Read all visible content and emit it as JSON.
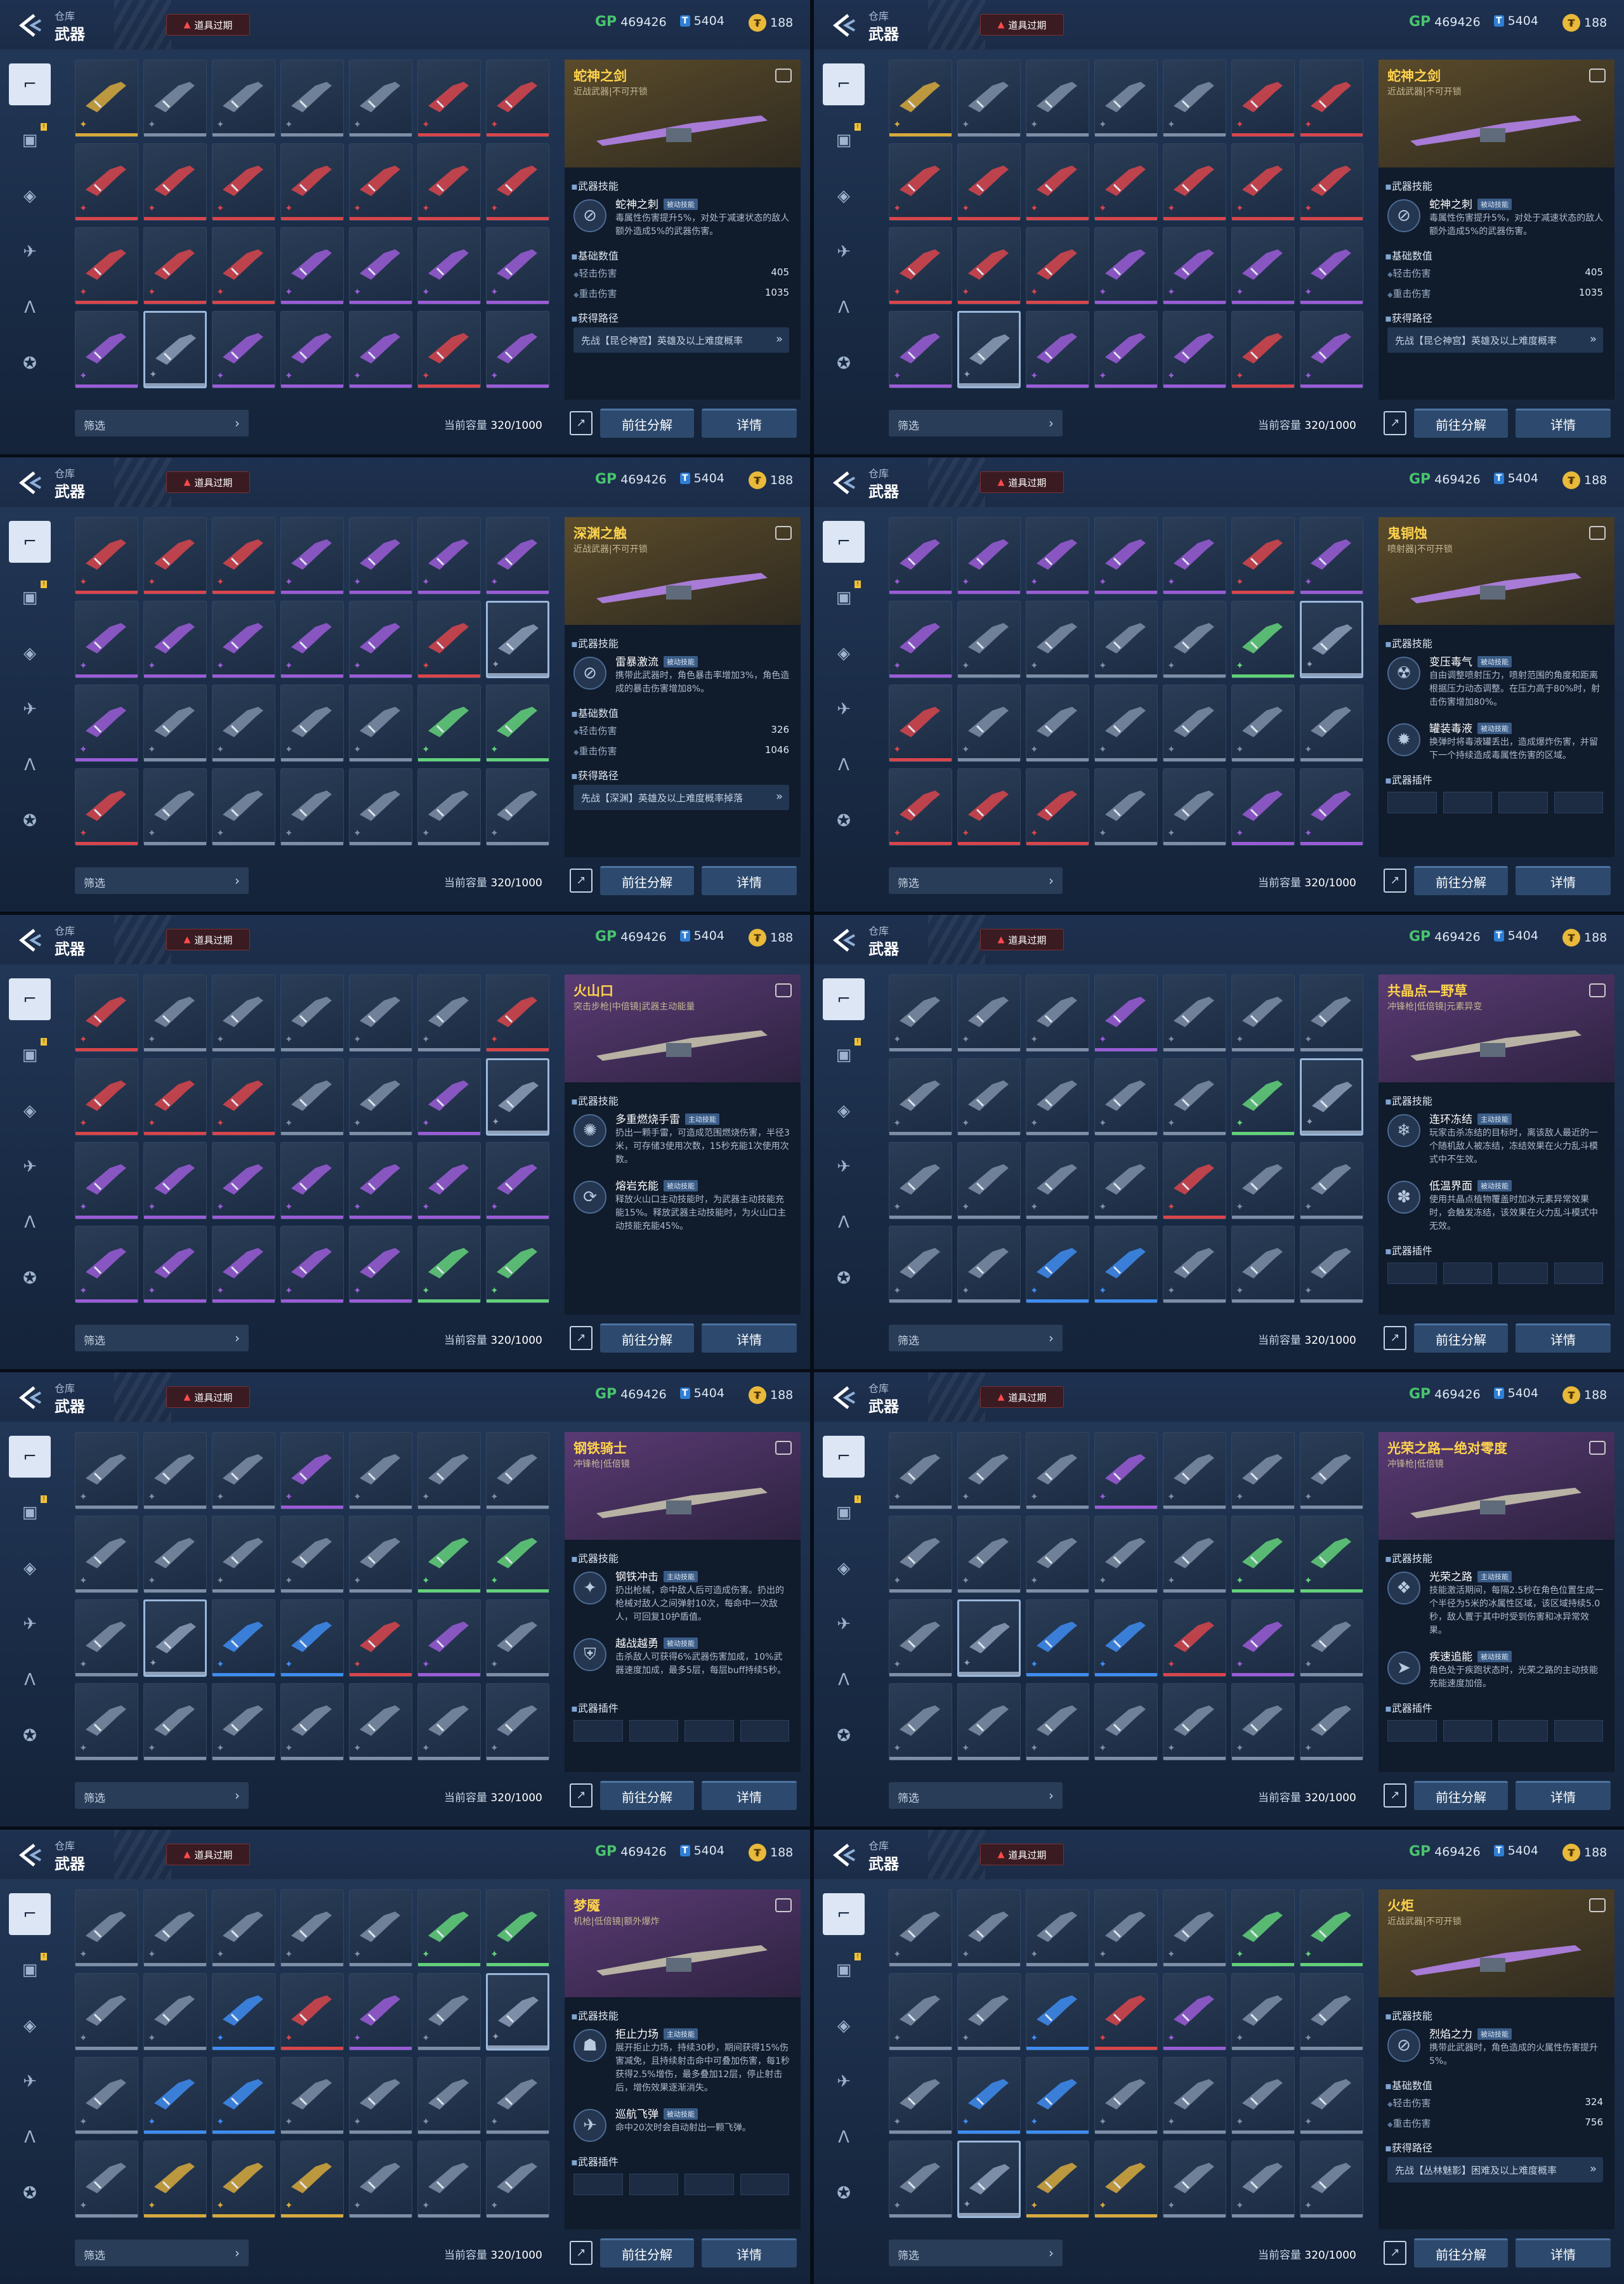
{
  "header": {
    "crumb": "仓库",
    "title": "武器",
    "warning": "道具过期",
    "gp": "469426",
    "tickets": "5404",
    "coins": "188"
  },
  "footer": {
    "filter": "筛选",
    "capacity_label": "当前容量",
    "capacity": "320/1000",
    "decompose": "前往分解",
    "details": "详情"
  },
  "tabs": [
    "pistol-icon",
    "armor-icon",
    "grenade-icon",
    "drone-icon",
    "chip-icon",
    "medal-icon"
  ],
  "colors": {
    "gold": "#d7a93c",
    "purple": "#9a5cd6",
    "red": "#d8454c",
    "green": "#63d17a",
    "blue": "#3e8cf0",
    "grey": "#7d8ea6"
  },
  "panels": [
    {
      "rows": [
        [
          "gold",
          "grey",
          "grey",
          "grey",
          "grey",
          "red",
          "red"
        ],
        [
          "red",
          "red",
          "red",
          "red",
          "red",
          "red",
          "red"
        ],
        [
          "red",
          "red",
          "red",
          "purple",
          "purple",
          "purple",
          "purple"
        ],
        [
          "purple",
          "sel",
          "purple",
          "purple",
          "purple",
          "red",
          "purple"
        ]
      ],
      "tone": "gold",
      "name": "蛇神之剑",
      "sub": "近战武器|不可开锁",
      "sec1": "武器技能",
      "skills": [
        {
          "n": "蛇神之刺",
          "t": "被动技能",
          "d": "毒属性伤害提升5%，对处于减速状态的敌人额外造成5%的武器伤害。",
          "i": "⊘"
        }
      ],
      "sec2": "基础数值",
      "stats": [
        [
          "轻击伤害",
          "405"
        ],
        [
          "重击伤害",
          "1035"
        ]
      ],
      "sec3": "获得路径",
      "path": "先战【昆仑神宫】英雄及以上难度概率"
    },
    {
      "rows": [
        [
          "gold",
          "grey",
          "grey",
          "grey",
          "grey",
          "red",
          "red"
        ],
        [
          "red",
          "red",
          "red",
          "red",
          "red",
          "red",
          "red"
        ],
        [
          "red",
          "red",
          "red",
          "purple",
          "purple",
          "purple",
          "purple"
        ],
        [
          "purple",
          "sel",
          "purple",
          "purple",
          "purple",
          "red",
          "purple"
        ]
      ],
      "tone": "gold",
      "name": "蛇神之剑",
      "sub": "近战武器|不可开锁",
      "sec1": "武器技能",
      "skills": [
        {
          "n": "蛇神之刺",
          "t": "被动技能",
          "d": "毒属性伤害提升5%，对处于减速状态的敌人额外造成5%的武器伤害。",
          "i": "⊘"
        }
      ],
      "sec2": "基础数值",
      "stats": [
        [
          "轻击伤害",
          "405"
        ],
        [
          "重击伤害",
          "1035"
        ]
      ],
      "sec3": "获得路径",
      "path": "先战【昆仑神宫】英雄及以上难度概率"
    },
    {
      "rows": [
        [
          "red",
          "red",
          "red",
          "purple",
          "purple",
          "purple",
          "purple"
        ],
        [
          "purple",
          "purple",
          "purple",
          "purple",
          "purple",
          "red",
          "sel"
        ],
        [
          "purple",
          "grey",
          "grey",
          "grey",
          "grey",
          "green",
          "green"
        ],
        [
          "red",
          "grey",
          "grey",
          "grey",
          "grey",
          "grey",
          "grey"
        ]
      ],
      "tone": "gold",
      "name": "深渊之触",
      "sub": "近战武器|不可开锁",
      "sec1": "武器技能",
      "skills": [
        {
          "n": "雷暴激流",
          "t": "被动技能",
          "d": "携带此武器时，角色暴击率增加3%，角色造成的暴击伤害增加8%。",
          "i": "⊘"
        }
      ],
      "sec2": "基础数值",
      "stats": [
        [
          "轻击伤害",
          "326"
        ],
        [
          "重击伤害",
          "1046"
        ]
      ],
      "sec3": "获得路径",
      "path": "先战【深渊】英雄及以上难度概率掉落"
    },
    {
      "rows": [
        [
          "purple",
          "purple",
          "purple",
          "purple",
          "purple",
          "red",
          "purple"
        ],
        [
          "purple",
          "grey",
          "grey",
          "grey",
          "grey",
          "green",
          "sel"
        ],
        [
          "red",
          "grey",
          "grey",
          "grey",
          "grey",
          "grey",
          "grey"
        ],
        [
          "red",
          "red",
          "red",
          "grey",
          "grey",
          "purple",
          "purple"
        ]
      ],
      "tone": "gold",
      "name": "鬼铜蚀",
      "sub": "喷射器|不可开锁",
      "sec1": "武器技能",
      "skills": [
        {
          "n": "变压毒气",
          "t": "被动技能",
          "d": "自由调整喷射压力，喷射范围的角度和距离根据压力动态调整。在压力高于80%时，射击伤害增加80%。",
          "i": "☢"
        },
        {
          "n": "罐装毒液",
          "t": "被动技能",
          "d": "换弹时将毒液罐丢出，造成爆炸伤害，并留下一个持续造成毒属性伤害的区域。",
          "i": "✹"
        }
      ],
      "sec2": "武器插件",
      "stats": [],
      "sec3": "",
      "path": ""
    },
    {
      "rows": [
        [
          "red",
          "grey",
          "grey",
          "grey",
          "grey",
          "grey",
          "red"
        ],
        [
          "red",
          "red",
          "red",
          "grey",
          "grey",
          "purple",
          "sel"
        ],
        [
          "purple",
          "purple",
          "purple",
          "purple",
          "purple",
          "purple",
          "purple"
        ],
        [
          "purple",
          "purple",
          "purple",
          "purple",
          "purple",
          "green",
          "green"
        ]
      ],
      "tone": "purple",
      "name": "火山口",
      "sub": "突击步枪|中倍镜|武器主动能量",
      "sec1": "武器技能",
      "skills": [
        {
          "n": "多重燃烧手雷",
          "t": "主动技能",
          "d": "扔出一颗手雷，可造成范围燃烧伤害，半径3米，可存储3使用次数，15秒充能1次使用次数。",
          "i": "✺"
        },
        {
          "n": "熔岩充能",
          "t": "被动技能",
          "d": "释放火山口主动技能时，为武器主动技能充能15%。释放武器主动技能时，为火山口主动技能充能45%。",
          "i": "⟳"
        }
      ],
      "sec2": "",
      "stats": [],
      "sec3": "",
      "path": ""
    },
    {
      "rows": [
        [
          "grey",
          "grey",
          "grey",
          "purple",
          "grey",
          "grey",
          "grey"
        ],
        [
          "grey",
          "grey",
          "grey",
          "grey",
          "grey",
          "green",
          "sel"
        ],
        [
          "grey",
          "grey",
          "grey",
          "grey",
          "red",
          "grey",
          "grey"
        ],
        [
          "grey",
          "grey",
          "blue",
          "blue",
          "grey",
          "grey",
          "grey"
        ]
      ],
      "tone": "purple",
      "name": "共晶点—野草",
      "sub": "冲锋枪|低倍镜|元素异变",
      "sec1": "武器技能",
      "skills": [
        {
          "n": "连环冻结",
          "t": "主动技能",
          "d": "玩家击杀冻结的目标时，离该敌人最近的一个随机敌人被冻结，冻结效果在火力乱斗模式中不生效。",
          "i": "❄"
        },
        {
          "n": "低温界面",
          "t": "被动技能",
          "d": "使用共晶点植物覆盖时加冰元素异常效果时，会触发冻结，该效果在火力乱斗模式中无效。",
          "i": "✽"
        }
      ],
      "sec2": "武器插件",
      "stats": [],
      "sec3": "",
      "path": ""
    },
    {
      "rows": [
        [
          "grey",
          "grey",
          "grey",
          "purple",
          "grey",
          "grey",
          "grey"
        ],
        [
          "grey",
          "grey",
          "grey",
          "grey",
          "grey",
          "green",
          "green"
        ],
        [
          "grey",
          "sel",
          "blue",
          "blue",
          "red",
          "purple",
          "grey"
        ],
        [
          "grey",
          "grey",
          "grey",
          "grey",
          "grey",
          "grey",
          "grey"
        ]
      ],
      "tone": "purple",
      "name": "钢铁骑士",
      "sub": "冲锋枪|低倍镜",
      "sec1": "武器技能",
      "skills": [
        {
          "n": "钢铁冲击",
          "t": "主动技能",
          "d": "扔出枪械，命中敌人后可造成伤害。扔出的枪械对敌人之间弹射10次，每命中一次敌人，可回复10护盾值。",
          "i": "✦"
        },
        {
          "n": "越战越勇",
          "t": "被动技能",
          "d": "击杀敌人可获得6%武器伤害加成，10%武器速度加成，最多5层，每层buff持续5秒。",
          "i": "⛨"
        }
      ],
      "sec2": "武器插件",
      "stats": [],
      "sec3": "",
      "path": ""
    },
    {
      "rows": [
        [
          "grey",
          "grey",
          "grey",
          "purple",
          "grey",
          "grey",
          "grey"
        ],
        [
          "grey",
          "grey",
          "grey",
          "grey",
          "grey",
          "green",
          "green"
        ],
        [
          "grey",
          "sel",
          "blue",
          "blue",
          "red",
          "purple",
          "grey"
        ],
        [
          "grey",
          "grey",
          "grey",
          "grey",
          "grey",
          "grey",
          "grey"
        ]
      ],
      "tone": "purple",
      "name": "光荣之路—绝对零度",
      "sub": "冲锋枪|低倍镜",
      "sec1": "武器技能",
      "skills": [
        {
          "n": "光荣之路",
          "t": "主动技能",
          "d": "技能激活期间，每隔2.5秒在角色位置生成一个半径为5米的冰属性区域，该区域持续5.0秒，敌人置于其中时受到伤害和冰异常效果。",
          "i": "❖"
        },
        {
          "n": "疾速追能",
          "t": "被动技能",
          "d": "角色处于疾跑状态时，光荣之路的主动技能充能速度加倍。",
          "i": "➤"
        }
      ],
      "sec2": "武器插件",
      "stats": [],
      "sec3": "",
      "path": ""
    },
    {
      "rows": [
        [
          "grey",
          "grey",
          "grey",
          "grey",
          "grey",
          "green",
          "green"
        ],
        [
          "grey",
          "grey",
          "blue",
          "red",
          "purple",
          "grey",
          "sel"
        ],
        [
          "grey",
          "blue",
          "blue",
          "grey",
          "grey",
          "grey",
          "grey"
        ],
        [
          "grey",
          "gold",
          "gold",
          "gold",
          "grey",
          "grey",
          "grey"
        ]
      ],
      "tone": "purple",
      "name": "梦魇",
      "sub": "机枪|低倍镜|额外爆炸",
      "sec1": "武器技能",
      "skills": [
        {
          "n": "拒止力场",
          "t": "主动技能",
          "d": "展开拒止力场，持续30秒，期间获得15%伤害减免，且持续射击命中可叠加伤害，每1秒获得2.5%增伤，最多叠加12层，停止射击后，增伤效果逐渐消失。",
          "i": "☗"
        },
        {
          "n": "巡航飞弹",
          "t": "被动技能",
          "d": "命中20次时会自动射出一颗飞弹。",
          "i": "✈"
        }
      ],
      "sec2": "武器插件",
      "stats": [],
      "sec3": "",
      "path": ""
    },
    {
      "rows": [
        [
          "grey",
          "grey",
          "grey",
          "grey",
          "grey",
          "green",
          "green"
        ],
        [
          "grey",
          "grey",
          "blue",
          "red",
          "purple",
          "grey",
          "grey"
        ],
        [
          "grey",
          "blue",
          "blue",
          "grey",
          "grey",
          "grey",
          "grey"
        ],
        [
          "grey",
          "sel",
          "gold",
          "gold",
          "grey",
          "grey",
          "grey"
        ]
      ],
      "tone": "gold",
      "name": "火炬",
      "sub": "近战武器|不可开锁",
      "sec1": "武器技能",
      "skills": [
        {
          "n": "烈焰之力",
          "t": "被动技能",
          "d": "携带此武器时，角色造成的火属性伤害提升5%。",
          "i": "⊘"
        }
      ],
      "sec2": "基础数值",
      "stats": [
        [
          "轻击伤害",
          "324"
        ],
        [
          "重击伤害",
          "756"
        ]
      ],
      "sec3": "获得路径",
      "path": "先战【丛林魅影】困难及以上难度概率"
    }
  ]
}
